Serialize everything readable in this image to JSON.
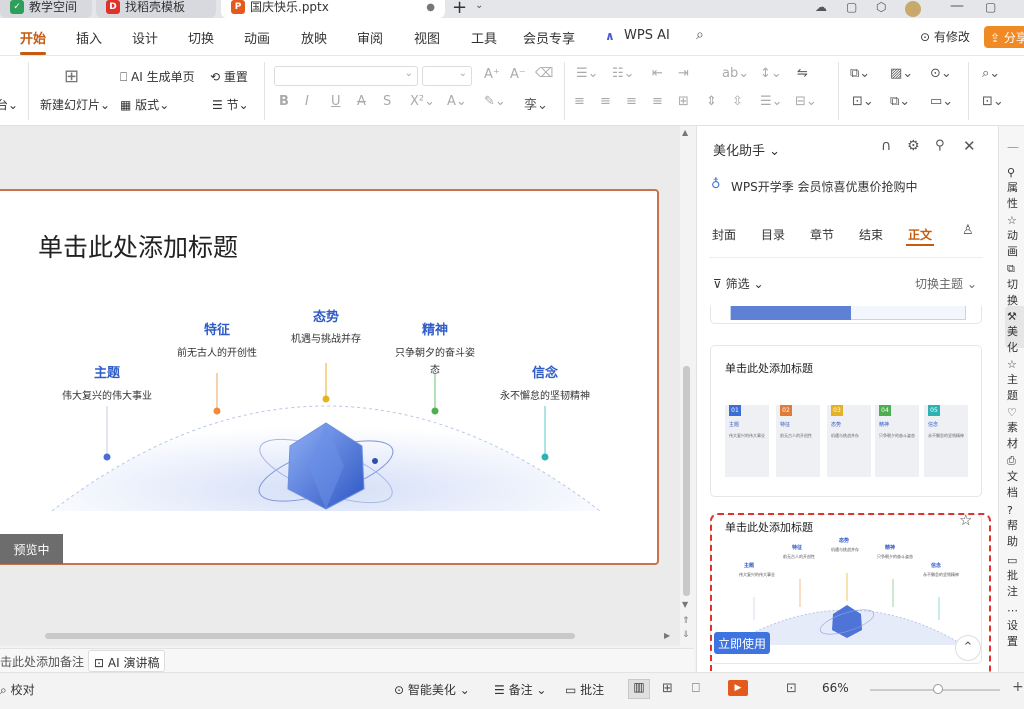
{
  "window": {
    "tabs": [
      {
        "label": "教学空间"
      },
      {
        "label": "找稻壳模板"
      },
      {
        "label": "国庆快乐.pptx"
      }
    ]
  },
  "menu": [
    "开始",
    "插入",
    "设计",
    "切换",
    "动画",
    "放映",
    "审阅",
    "视图",
    "工具",
    "会员专享",
    "WPS AI"
  ],
  "menu_right": {
    "revise": "有修改",
    "share": "分享"
  },
  "ribbon": {
    "new_slide": "新建幻灯片",
    "ai_single": "AI 生成单页",
    "reset": "重置",
    "layout": "版式",
    "section": "节"
  },
  "slide": {
    "title": "单击此处添加标题",
    "pillars": [
      {
        "title": "主题",
        "desc": "伟大复兴的伟大事业"
      },
      {
        "title": "特征",
        "desc": "前无古人的开创性"
      },
      {
        "title": "态势",
        "desc": "机遇与挑战并存"
      },
      {
        "title": "精神",
        "desc": "只争朝夕的奋斗姿态"
      },
      {
        "title": "信念",
        "desc": "永不懈怠的坚韧精神"
      }
    ],
    "preview_badge": "预览中"
  },
  "notes": {
    "placeholder": "击此处添加备注",
    "ai_script": "AI 演讲稿"
  },
  "panel": {
    "title": "美化助手",
    "promo": "WPS开学季 会员惊喜优惠价抢购中",
    "tabs": [
      "封面",
      "目录",
      "章节",
      "结束",
      "正文"
    ],
    "filter": "筛选",
    "switch_theme": "切换主题",
    "card_title": "单击此处添加标题",
    "use_now": "立即使用",
    "mini_nums": [
      "01",
      "02",
      "03",
      "04",
      "05"
    ]
  },
  "rightbar": [
    "属性",
    "动画",
    "切换",
    "美化",
    "主题",
    "素材",
    "文档",
    "帮助",
    "批注",
    "设置"
  ],
  "status": {
    "proofread": "校对",
    "smart_beautify": "智能美化",
    "notes": "备注",
    "comment": "批注",
    "zoom": "66%"
  },
  "colors": {
    "accent": "#c55a11",
    "primary_blue": "#2f5cc9",
    "highlight_red": "#e0312a",
    "mini_colors": [
      "#3b6fd8",
      "#e07b39",
      "#e3b325",
      "#4caf50",
      "#2bb3b3"
    ]
  }
}
